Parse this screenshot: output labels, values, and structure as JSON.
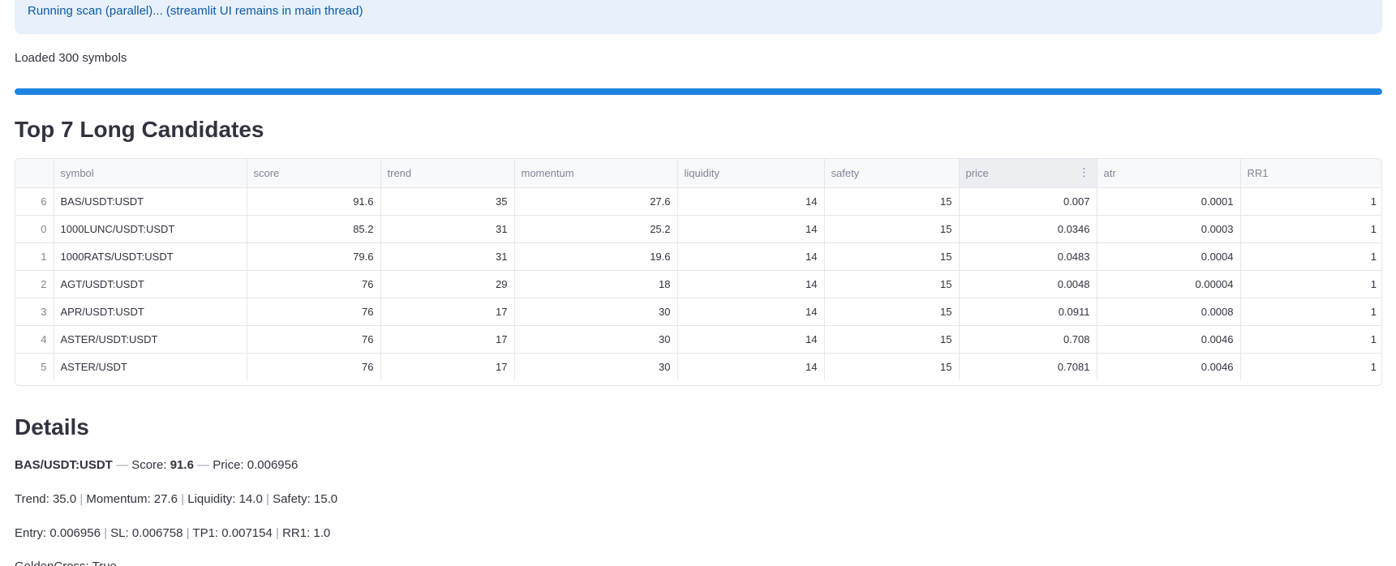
{
  "status": {
    "info_message": "Running scan (parallel)... (streamlit UI remains in main thread)",
    "loaded_text": "Loaded 300 symbols",
    "progress": 1.0
  },
  "top_section": {
    "heading": "Top 7 Long Candidates"
  },
  "table": {
    "columns": [
      "",
      "symbol",
      "score",
      "trend",
      "momentum",
      "liquidity",
      "safety",
      "price",
      "atr",
      "RR1"
    ],
    "rows": [
      [
        "6",
        "BAS/USDT:USDT",
        "91.6",
        "35",
        "27.6",
        "14",
        "15",
        "0.007",
        "0.0001",
        "1"
      ],
      [
        "0",
        "1000LUNC/USDT:USDT",
        "85.2",
        "31",
        "25.2",
        "14",
        "15",
        "0.0346",
        "0.0003",
        "1"
      ],
      [
        "1",
        "1000RATS/USDT:USDT",
        "79.6",
        "31",
        "19.6",
        "14",
        "15",
        "0.0483",
        "0.0004",
        "1"
      ],
      [
        "2",
        "AGT/USDT:USDT",
        "76",
        "29",
        "18",
        "14",
        "15",
        "0.0048",
        "0.00004",
        "1"
      ],
      [
        "3",
        "APR/USDT:USDT",
        "76",
        "17",
        "30",
        "14",
        "15",
        "0.0911",
        "0.0008",
        "1"
      ],
      [
        "4",
        "ASTER/USDT:USDT",
        "76",
        "17",
        "30",
        "14",
        "15",
        "0.708",
        "0.0046",
        "1"
      ],
      [
        "5",
        "ASTER/USDT",
        "76",
        "17",
        "30",
        "14",
        "15",
        "0.7081",
        "0.0046",
        "1"
      ]
    ],
    "column_menu_icon": "kebab-menu-icon"
  },
  "details": {
    "heading": "Details",
    "symbol": "BAS/USDT:USDT",
    "score_label": "Score:",
    "score_value": "91.6",
    "price_label": "Price: 0.006956",
    "dash": "—",
    "metrics": [
      "Trend: 35.0",
      "Momentum: 27.6",
      "Liquidity: 14.0",
      "Safety: 15.0"
    ],
    "levels": [
      "Entry: 0.006956",
      "SL: 0.006758",
      "TP1: 0.007154",
      "RR1: 1.0"
    ],
    "golden_cross": "GoldenCross: True",
    "pipe": "|"
  },
  "colors": {
    "accent": "#1c83e1",
    "info_bg": "#e8f1fb",
    "info_text": "#0b5aa6"
  }
}
